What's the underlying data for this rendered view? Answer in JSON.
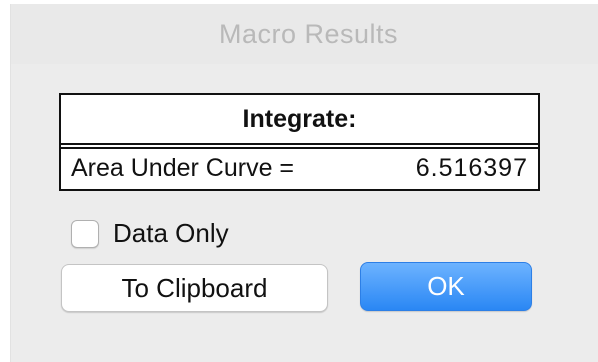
{
  "window": {
    "title": "Macro Results"
  },
  "results": {
    "header": "Integrate:",
    "rows": [
      {
        "label": "Area Under Curve =",
        "value": "6.516397"
      }
    ]
  },
  "options": {
    "data_only_label": "Data Only",
    "data_only_checked": false
  },
  "buttons": {
    "clipboard_label": "To Clipboard",
    "ok_label": "OK"
  },
  "colors": {
    "accent": "#2a87f4",
    "window_bg": "#ececec"
  }
}
